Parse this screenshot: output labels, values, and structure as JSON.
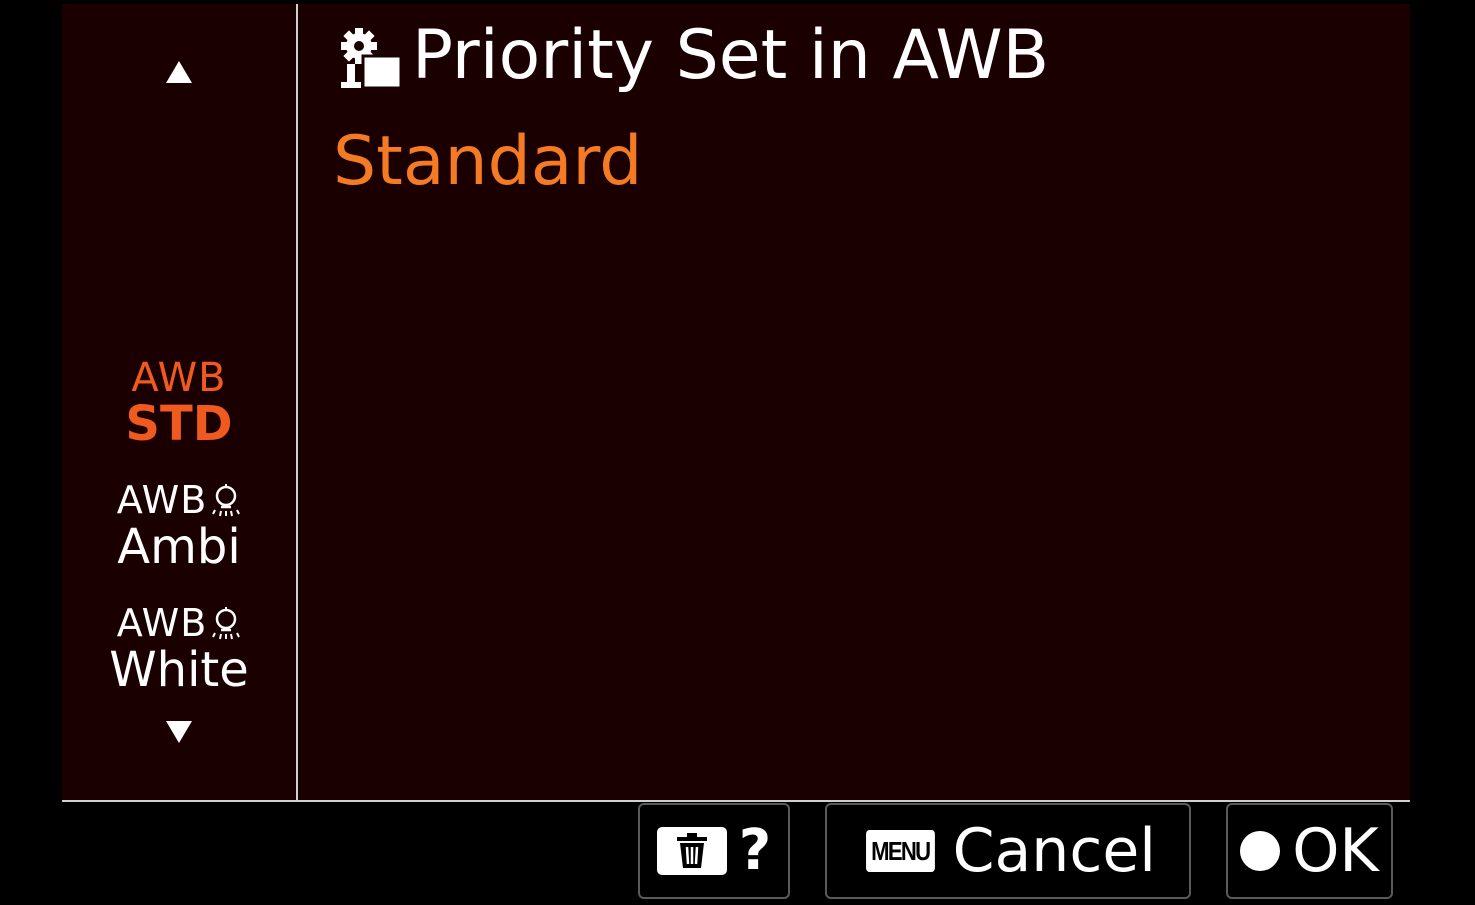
{
  "header": {
    "title": "Priority Set in AWB",
    "icon": "camera-settings-icon"
  },
  "current_value": "Standard",
  "options": [
    {
      "top": "AWB",
      "bottom": "STD",
      "selected": true
    },
    {
      "top": "AWB",
      "bottom": "Ambi",
      "icon": "bulb-icon",
      "selected": false
    },
    {
      "top": "AWB",
      "bottom": "White",
      "icon": "bulb-icon",
      "selected": false
    }
  ],
  "footer": {
    "help_label": "?",
    "menu_key": "MENU",
    "cancel_label": "Cancel",
    "ok_label": "OK"
  },
  "colors": {
    "background": "#1a0000",
    "selected": "#f05a1e",
    "value": "#f47a24"
  }
}
